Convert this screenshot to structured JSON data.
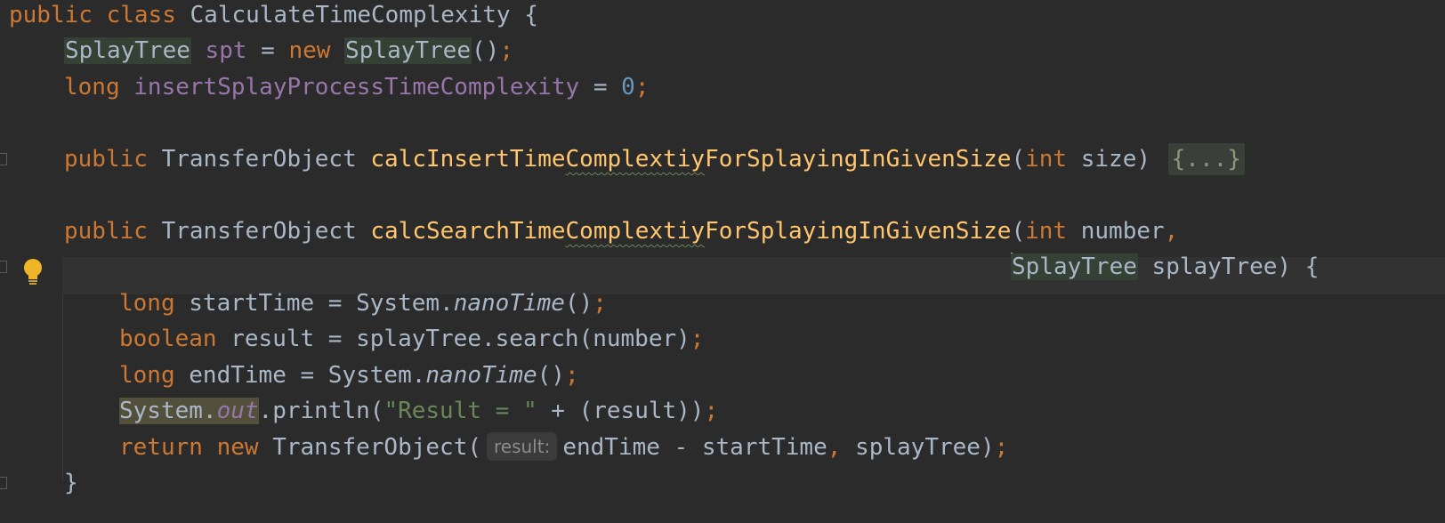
{
  "editor": {
    "lines": [
      {
        "tokens": [
          {
            "text": "public",
            "cls": "kw"
          },
          {
            "text": " "
          },
          {
            "text": "class",
            "cls": "kw"
          },
          {
            "text": " CalculateTimeComplexity {"
          }
        ]
      },
      {
        "tokens": [
          {
            "text": "SplayTree",
            "cls": "type-hl"
          },
          {
            "text": " "
          },
          {
            "text": "spt",
            "cls": "field"
          },
          {
            "text": " = "
          },
          {
            "text": "new",
            "cls": "kw"
          },
          {
            "text": " "
          },
          {
            "text": "SplayTree",
            "cls": "type-hl"
          },
          {
            "text": "()"
          },
          {
            "text": ";",
            "cls": "kw"
          }
        ]
      },
      {
        "tokens": [
          {
            "text": "long",
            "cls": "kw"
          },
          {
            "text": " "
          },
          {
            "text": "insertSplayProcessTimeComplexity",
            "cls": "field"
          },
          {
            "text": " = "
          },
          {
            "text": "0",
            "cls": "num"
          },
          {
            "text": ";",
            "cls": "kw"
          }
        ]
      },
      {
        "tokens": []
      },
      {
        "tokens": [
          {
            "text": "public",
            "cls": "kw"
          },
          {
            "text": " TransferObject "
          },
          {
            "text": "calcInsertTime",
            "cls": "method"
          },
          {
            "text": "Complextiy",
            "cls": "method squiggle"
          },
          {
            "text": "ForSplayingInGivenSize",
            "cls": "method"
          },
          {
            "text": "("
          },
          {
            "text": "int",
            "cls": "kw"
          },
          {
            "text": " size) "
          },
          {
            "text": "{...}",
            "cls": "fold-box"
          }
        ]
      },
      {
        "tokens": []
      },
      {
        "tokens": [
          {
            "text": "public",
            "cls": "kw"
          },
          {
            "text": " TransferObject "
          },
          {
            "text": "calcSearchTime",
            "cls": "method"
          },
          {
            "text": "Complextiy",
            "cls": "method squiggle"
          },
          {
            "text": "ForSplayingInGivenSize",
            "cls": "method"
          },
          {
            "text": "("
          },
          {
            "text": "int",
            "cls": "kw"
          },
          {
            "text": " number"
          },
          {
            "text": ",",
            "cls": "kw"
          }
        ]
      },
      {
        "tokens": [
          {
            "text": "",
            "cls": "caret"
          },
          {
            "text": "SplayTree",
            "cls": "type-hl"
          },
          {
            "text": " splayTree) {"
          }
        ]
      },
      {
        "tokens": [
          {
            "text": "long",
            "cls": "kw"
          },
          {
            "text": " startTime = System."
          },
          {
            "text": "nanoTime",
            "cls": "static-i"
          },
          {
            "text": "()"
          },
          {
            "text": ";",
            "cls": "kw"
          }
        ]
      },
      {
        "tokens": [
          {
            "text": "boolean",
            "cls": "kw"
          },
          {
            "text": " result = splayTree.search(number)"
          },
          {
            "text": ";",
            "cls": "kw"
          }
        ]
      },
      {
        "tokens": [
          {
            "text": "long",
            "cls": "kw"
          },
          {
            "text": " endTime = System."
          },
          {
            "text": "nanoTime",
            "cls": "static-i"
          },
          {
            "text": "()"
          },
          {
            "text": ";",
            "cls": "kw"
          }
        ]
      },
      {
        "tokens": [
          {
            "text": "System.",
            "cls": "sys-hl"
          },
          {
            "text": "out",
            "cls": "field-i sys-hl"
          },
          {
            "text": ".println("
          },
          {
            "text": "\"Result = \"",
            "cls": "str"
          },
          {
            "text": " + (result))"
          },
          {
            "text": ";",
            "cls": "kw"
          }
        ]
      },
      {
        "tokens": [
          {
            "text": "return",
            "cls": "kw"
          },
          {
            "text": " "
          },
          {
            "text": "new",
            "cls": "kw"
          },
          {
            "text": " TransferObject("
          },
          {
            "text": "result:",
            "cls": "hint"
          },
          {
            "text": "endTime - startTime"
          },
          {
            "text": ",",
            "cls": "kw"
          },
          {
            "text": " splayTree)"
          },
          {
            "text": ";",
            "cls": "kw"
          }
        ]
      },
      {
        "tokens": [
          {
            "text": "}"
          }
        ]
      }
    ]
  },
  "gutter": {
    "intention_icon": "lightbulb-icon"
  },
  "colors": {
    "background": "#2b2b2b",
    "keyword": "#cc7832",
    "field": "#9876aa",
    "method": "#ffc66d",
    "number": "#6897bb",
    "string": "#6a8759",
    "default": "#a9b7c6"
  }
}
